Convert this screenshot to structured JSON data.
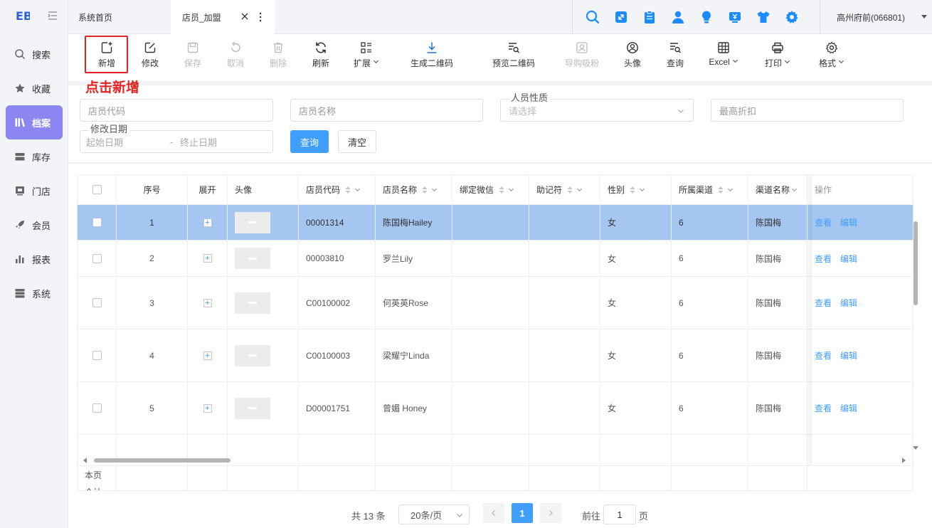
{
  "app": {
    "logo_text": "EB",
    "tabs": [
      {
        "label": "系统首页",
        "active": false
      },
      {
        "label": "店员_加盟",
        "active": true
      }
    ],
    "user": "高州府前(066801)"
  },
  "sidebar": {
    "items": [
      {
        "label": "搜索",
        "icon": "search-icon",
        "active": false
      },
      {
        "label": "收藏",
        "icon": "star-icon",
        "active": false
      },
      {
        "label": "档案",
        "icon": "books-icon",
        "active": true
      },
      {
        "label": "库存",
        "icon": "inventory-icon",
        "active": false
      },
      {
        "label": "门店",
        "icon": "store-icon",
        "active": false
      },
      {
        "label": "会员",
        "icon": "rocket-icon",
        "active": false
      },
      {
        "label": "报表",
        "icon": "bar-chart-icon",
        "active": false
      },
      {
        "label": "系统",
        "icon": "server-icon",
        "active": false
      }
    ]
  },
  "top_icons": [
    "search-icon",
    "resize-icon",
    "clipboard-icon",
    "user-icon",
    "bulb-icon",
    "money-icon",
    "shirt-icon",
    "gear-icon"
  ],
  "toolbar": {
    "buttons": [
      {
        "label": "新增",
        "icon": "add-file-icon",
        "disabled": false
      },
      {
        "label": "修改",
        "icon": "edit-icon",
        "disabled": false
      },
      {
        "label": "保存",
        "icon": "save-icon",
        "disabled": true
      },
      {
        "label": "取消",
        "icon": "undo-icon",
        "disabled": true
      },
      {
        "label": "删除",
        "icon": "trash-icon",
        "disabled": true
      },
      {
        "label": "刷新",
        "icon": "refresh-icon",
        "disabled": false
      },
      {
        "label": "扩展",
        "icon": "grid-list-icon",
        "disabled": false,
        "dropdown": true
      },
      {
        "label": "生成二维码",
        "icon": "download-icon",
        "disabled": false
      },
      {
        "label": "预览二维码",
        "icon": "list-search-icon",
        "disabled": false
      },
      {
        "label": "导购吸粉",
        "icon": "scan-user-icon",
        "disabled": true
      },
      {
        "label": "头像",
        "icon": "avatar-circle-icon",
        "disabled": false
      },
      {
        "label": "查询",
        "icon": "list-search-icon",
        "disabled": false
      },
      {
        "label": "Excel",
        "icon": "table-icon",
        "disabled": false,
        "dropdown": true
      },
      {
        "label": "打印",
        "icon": "printer-icon",
        "disabled": false,
        "dropdown": true
      },
      {
        "label": "格式",
        "icon": "gear-icon",
        "disabled": false,
        "dropdown": true
      }
    ],
    "annotation": "点击新增"
  },
  "filters": {
    "staff_code": {
      "placeholder": "店员代码"
    },
    "staff_name": {
      "placeholder": "店员名称"
    },
    "staff_type": {
      "label": "人员性质",
      "placeholder": "请选择"
    },
    "max_discount": {
      "placeholder": "最高折扣"
    },
    "modified_date": {
      "label": "修改日期",
      "start_placeholder": "起始日期",
      "separator": "-",
      "end_placeholder": "终止日期"
    },
    "query_label": "查询",
    "clear_label": "清空"
  },
  "table": {
    "columns": [
      "序号",
      "展开",
      "头像",
      "店员代码",
      "店员名称",
      "绑定微信",
      "助记符",
      "性别",
      "所属渠道",
      "渠道名称",
      "操作"
    ],
    "rows": [
      {
        "index": "1",
        "code": "00001314",
        "name": "陈国梅Hailey",
        "wechat": "",
        "mnemonic": "",
        "gender": "女",
        "channel": "6",
        "channel_name": "陈国梅",
        "selected": true
      },
      {
        "index": "2",
        "code": "00003810",
        "name": "罗兰Lily",
        "wechat": "",
        "mnemonic": "",
        "gender": "女",
        "channel": "6",
        "channel_name": "陈国梅",
        "selected": false
      },
      {
        "index": "3",
        "code": "C00100002",
        "name": "何英英Rose",
        "wechat": "",
        "mnemonic": "",
        "gender": "女",
        "channel": "6",
        "channel_name": "陈国梅",
        "selected": false
      },
      {
        "index": "4",
        "code": "C00100003",
        "name": "梁耀宁Linda",
        "wechat": "",
        "mnemonic": "",
        "gender": "女",
        "channel": "6",
        "channel_name": "陈国梅",
        "selected": false
      },
      {
        "index": "5",
        "code": "D00001751",
        "name": "曾媚 Honey",
        "wechat": "",
        "mnemonic": "",
        "gender": "女",
        "channel": "6",
        "channel_name": "陈国梅",
        "selected": false
      }
    ],
    "action_view": "查看",
    "action_edit": "编辑",
    "summary_page": "本页",
    "summary_total": "合计"
  },
  "pagination": {
    "total": "共 13 条",
    "page_size": "20条/页",
    "current_page": "1",
    "goto_label": "前往",
    "goto_value": "1",
    "page_unit": "页"
  },
  "colors": {
    "accent": "#409eff",
    "sidebar_active": "#8c86f0",
    "selected_row": "#a4c6f1",
    "annotation": "#e32222",
    "top_icon": "#1a8cff"
  }
}
